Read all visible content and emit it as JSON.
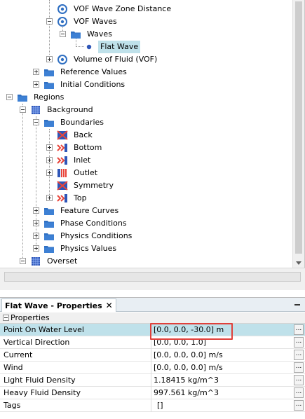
{
  "tree": {
    "items": [
      {
        "label": "VOF Wave Zone Distance",
        "icon": "dial-node-icon",
        "expander": "none"
      },
      {
        "label": "VOF Waves",
        "icon": "dial-node-icon",
        "expander": "minus"
      },
      {
        "label": "Waves",
        "icon": "folder-icon",
        "expander": "minus"
      },
      {
        "label": "Flat Wave",
        "icon": "bullet-node-icon",
        "expander": "none",
        "selected": true
      },
      {
        "label": "Volume of Fluid (VOF)",
        "icon": "dial-node-icon",
        "expander": "plus"
      },
      {
        "label": "Reference Values",
        "icon": "folder-icon",
        "expander": "plus"
      },
      {
        "label": "Initial Conditions",
        "icon": "folder-icon",
        "expander": "plus"
      },
      {
        "label": "Regions",
        "icon": "folder-icon",
        "expander": "minus"
      },
      {
        "label": "Background",
        "icon": "region-icon",
        "expander": "minus"
      },
      {
        "label": "Boundaries",
        "icon": "folder-icon",
        "expander": "minus"
      },
      {
        "label": "Back",
        "icon": "boundary-plain-icon",
        "expander": "none"
      },
      {
        "label": "Bottom",
        "icon": "boundary-arrows-icon",
        "expander": "plus"
      },
      {
        "label": "Inlet",
        "icon": "boundary-arrows-icon",
        "expander": "plus"
      },
      {
        "label": "Outlet",
        "icon": "boundary-outlet-icon",
        "expander": "plus"
      },
      {
        "label": "Symmetry",
        "icon": "boundary-plain-icon",
        "expander": "none"
      },
      {
        "label": "Top",
        "icon": "boundary-arrows-icon",
        "expander": "plus"
      },
      {
        "label": "Feature Curves",
        "icon": "folder-icon",
        "expander": "plus"
      },
      {
        "label": "Phase Conditions",
        "icon": "folder-icon",
        "expander": "plus"
      },
      {
        "label": "Physics Conditions",
        "icon": "folder-icon",
        "expander": "plus"
      },
      {
        "label": "Physics Values",
        "icon": "folder-icon",
        "expander": "plus"
      },
      {
        "label": "Overset",
        "icon": "region-icon",
        "expander": "minus"
      }
    ]
  },
  "properties_panel": {
    "tab_title": "Flat Wave - Properties",
    "close_glyph": "✕",
    "section_label": "Properties",
    "ellipsis_label": "...",
    "rows": [
      {
        "name": "Point On Water Level",
        "value": "[0.0, 0.0, -30.0] m",
        "selected": true
      },
      {
        "name": "Vertical Direction",
        "value": "[0.0, 0.0, 1.0]"
      },
      {
        "name": "Current",
        "value": "[0.0, 0.0, 0.0] m/s"
      },
      {
        "name": "Wind",
        "value": "[0.0, 0.0, 0.0] m/s"
      },
      {
        "name": "Light Fluid Density",
        "value": "1.18415 kg/m^3"
      },
      {
        "name": "Heavy Fluid Density",
        "value": "997.561 kg/m^3"
      },
      {
        "name": "Tags",
        "value": "[]"
      }
    ]
  },
  "colors": {
    "selection": "#bfe1ea",
    "folder": "#2f6fc2",
    "highlight_box": "#e0403a"
  }
}
